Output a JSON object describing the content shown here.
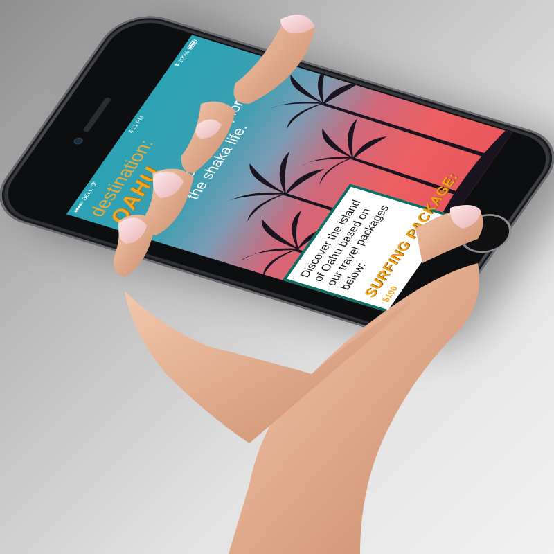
{
  "status_bar": {
    "carrier": "BELL",
    "time": "4:21 PM",
    "battery": "100%"
  },
  "app": {
    "title_prefix": "destination:",
    "title_place": "OAHU",
    "tagline": "Discover + explore the shaka life."
  },
  "card": {
    "text": "Discover the island of Oahu based on our travel packages below:",
    "heading": "SURFING PACKAGE:",
    "subtext": "$100"
  },
  "icons": {
    "signal": "signal-dots-icon",
    "wifi": "wifi-icon",
    "bluetooth": "bluetooth-icon",
    "battery": "battery-icon",
    "home": "home-button-icon"
  },
  "colors": {
    "brand_orange": "#f2a51d",
    "card_border": "#0f6e64",
    "sky_teal": "#2aa3b4",
    "sunset_red": "#ec5f62"
  }
}
